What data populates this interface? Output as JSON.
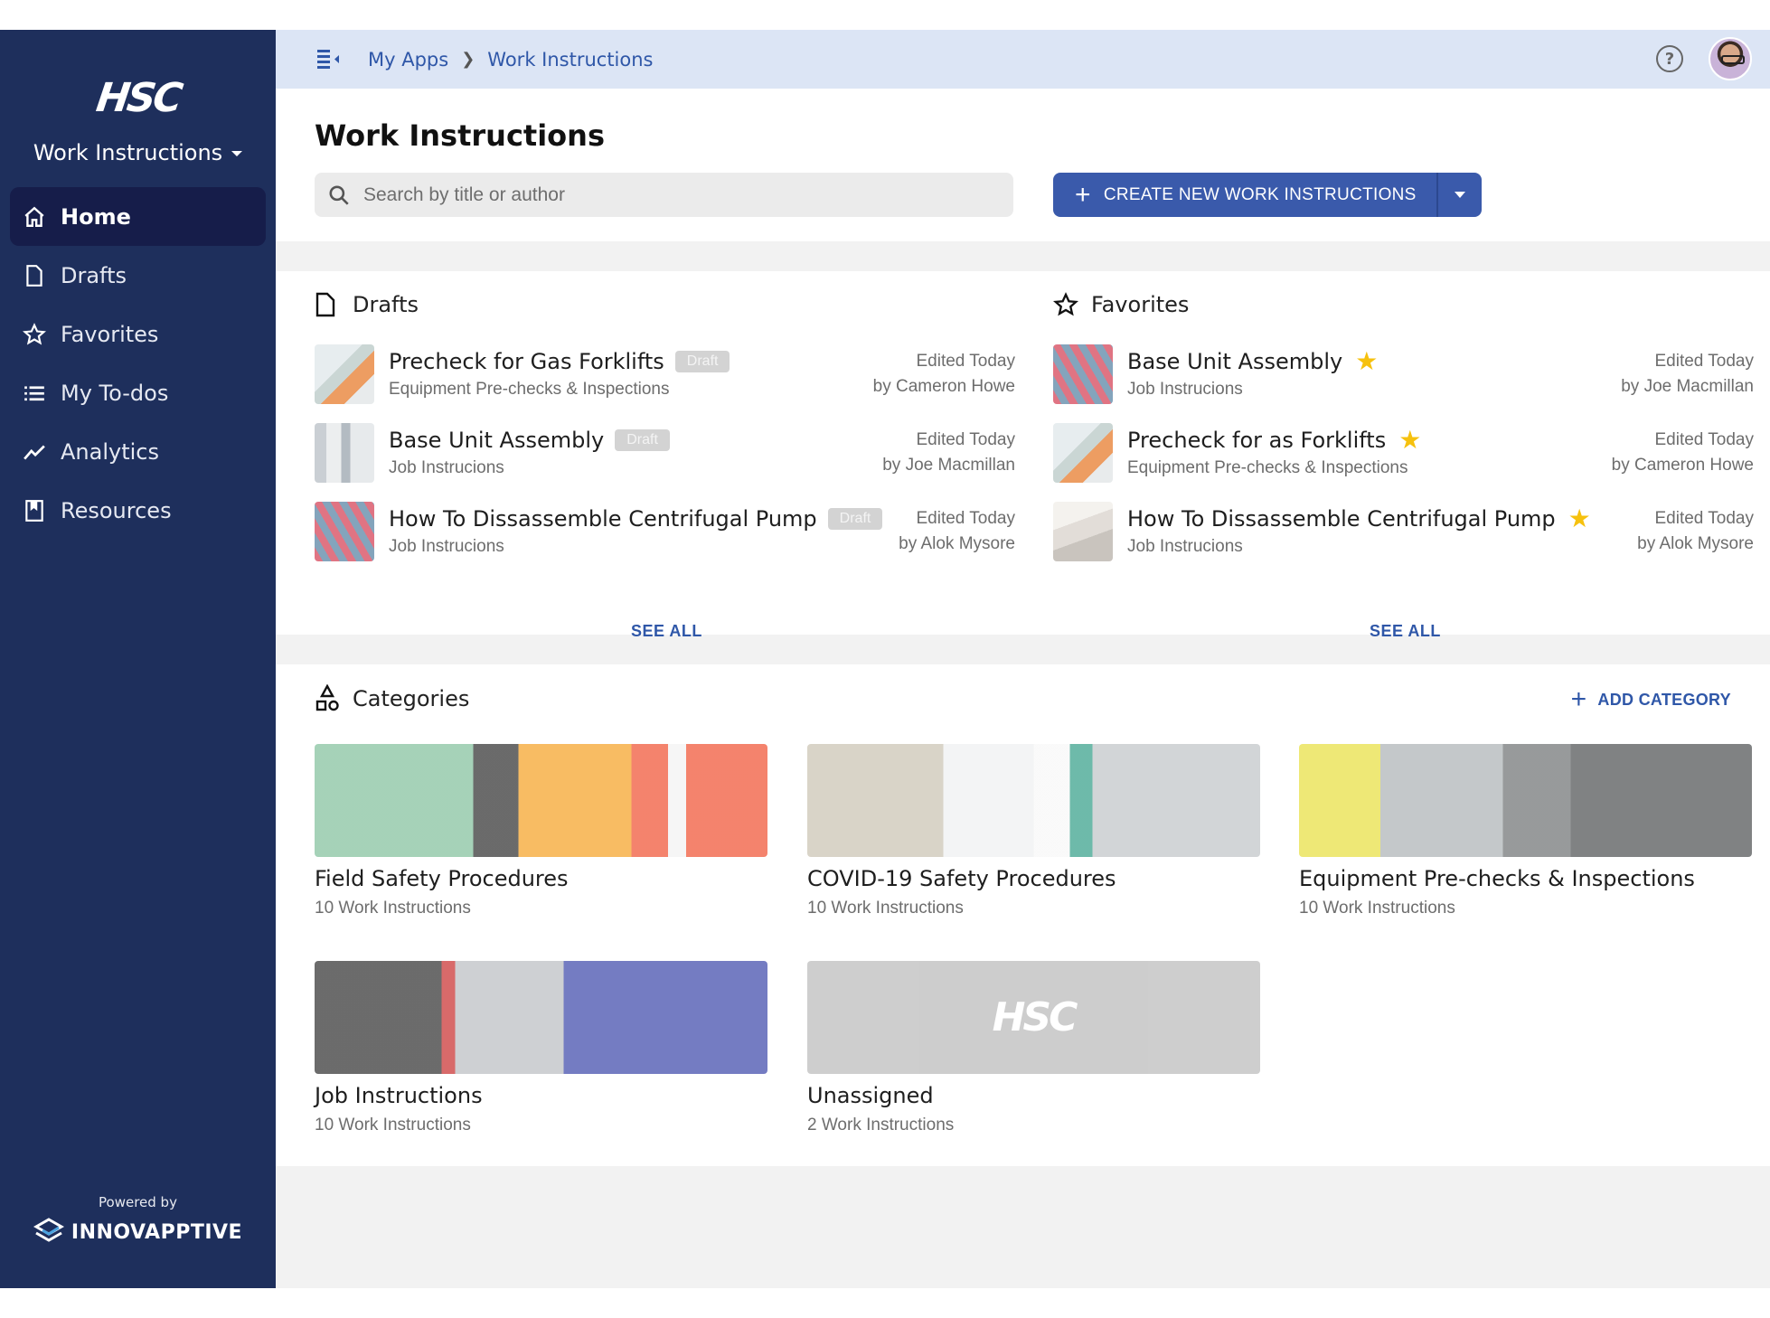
{
  "sidebar": {
    "logo": "HSC",
    "app_name": "Work Instructions",
    "items": [
      {
        "label": "Home",
        "icon": "home-icon",
        "active": true
      },
      {
        "label": "Drafts",
        "icon": "document-icon",
        "active": false
      },
      {
        "label": "Favorites",
        "icon": "star-outline-icon",
        "active": false
      },
      {
        "label": "My To-dos",
        "icon": "list-icon",
        "active": false
      },
      {
        "label": "Analytics",
        "icon": "trend-line-icon",
        "active": false
      },
      {
        "label": "Resources",
        "icon": "bookmark-book-icon",
        "active": false
      }
    ],
    "powered_by": "Powered by",
    "brand": "INNOVAPPTIVE"
  },
  "topbar": {
    "breadcrumb": [
      "My Apps",
      "Work Instructions"
    ],
    "help_icon": "help-circle-icon",
    "avatar": "user-avatar"
  },
  "header": {
    "title": "Work Instructions",
    "search_placeholder": "Search by title or author",
    "search_value": "",
    "create_label": "CREATE NEW WORK INSTRUCTIONS"
  },
  "drafts": {
    "title": "Drafts",
    "see_all": "SEE ALL",
    "items": [
      {
        "title": "Precheck for Gas Forklifts",
        "badge": "Draft",
        "category": "Equipment Pre-checks & Inspections",
        "edited": "Edited Today",
        "author": "by Cameron Howe"
      },
      {
        "title": "Base Unit Assembly",
        "badge": "Draft",
        "category": "Job Instrucions",
        "edited": "Edited Today",
        "author": "by Joe Macmillan"
      },
      {
        "title": "How To Dissassemble Centrifugal Pump",
        "badge": "Draft",
        "category": "Job Instrucions",
        "edited": "Edited Today",
        "author": "by Alok Mysore"
      }
    ]
  },
  "favorites": {
    "title": "Favorites",
    "see_all": "SEE ALL",
    "items": [
      {
        "title": "Base Unit Assembly",
        "category": "Job Instrucions",
        "edited": "Edited Today",
        "author": "by Joe Macmillan"
      },
      {
        "title": "Precheck for as Forklifts",
        "category": "Equipment Pre-checks & Inspections",
        "edited": "Edited Today",
        "author": "by Cameron Howe"
      },
      {
        "title": "How To Dissassemble Centrifugal Pump",
        "category": "Job Instrucions",
        "edited": "Edited Today",
        "author": "by Alok Mysore"
      }
    ]
  },
  "categories": {
    "title": "Categories",
    "add_label": "ADD CATEGORY",
    "items": [
      {
        "title": "Field Safety Procedures",
        "count": "10 Work Instructions"
      },
      {
        "title": "COVID-19 Safety Procedures",
        "count": "10 Work Instructions"
      },
      {
        "title": "Equipment Pre-checks & Inspections",
        "count": "10 Work Instructions"
      },
      {
        "title": "Job Instructions",
        "count": "10 Work Instructions"
      },
      {
        "title": "Unassigned",
        "count": "2 Work Instructions",
        "placeholder_logo": "HSC"
      }
    ]
  },
  "colors": {
    "sidebar": "#1e2f5c",
    "sidebar_active": "#161d4a",
    "topbar": "#dce5f5",
    "accent": "#3a5aab",
    "link": "#2f57a8",
    "star": "#f6c10e",
    "badge": "#d3d3d3"
  }
}
